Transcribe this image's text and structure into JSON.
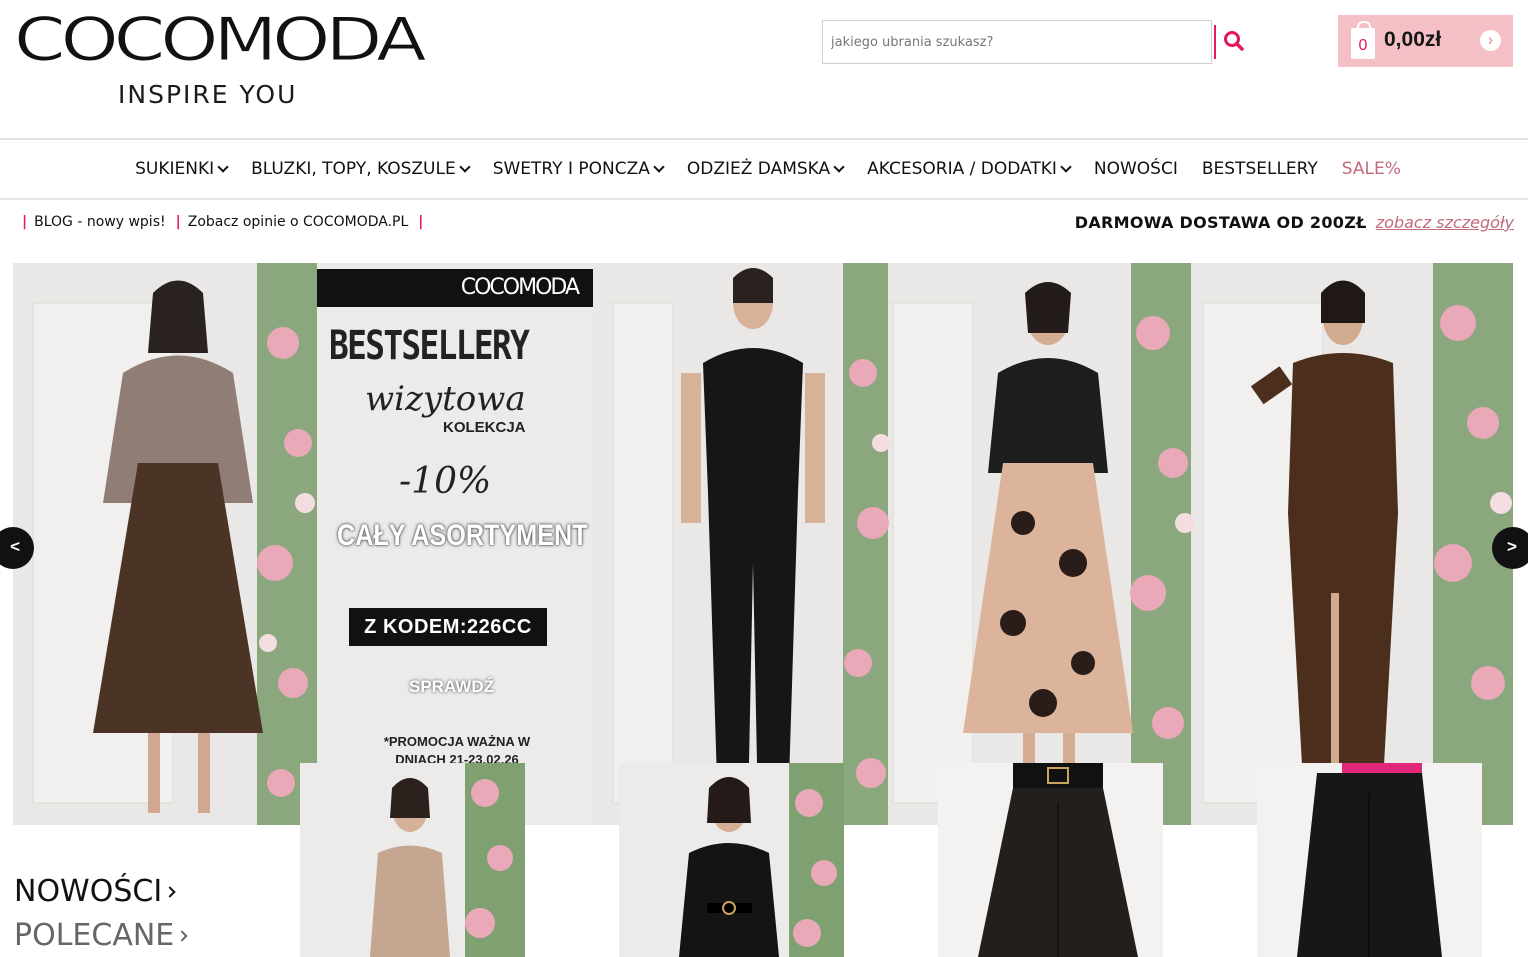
{
  "header": {
    "logo_text": "COCOMODA",
    "logo_tagline": "INSPIRE YOU",
    "search_placeholder": "jakiego ubrania szukasz?",
    "search_icon": "search-icon",
    "cart_count": "0",
    "cart_total": "0,00zł",
    "cart_arrow": "›",
    "accent_color": "#e4185f",
    "cart_bg": "#f4c0c6"
  },
  "nav": {
    "items": [
      {
        "label": "SUKIENKI"
      },
      {
        "label": "BLUZKI, TOPY, KOSZULE"
      },
      {
        "label": "SWETRY I PONCZA"
      },
      {
        "label": "ODZIEŻ DAMSKA"
      },
      {
        "label": "AKCESORIA / DODATKI"
      },
      {
        "label": "NOWOŚCI"
      },
      {
        "label": "BESTSELLERY"
      },
      {
        "label": "SALE%"
      }
    ],
    "sale_color": "#c06a7c"
  },
  "info_bar": {
    "links": [
      "BLOG - nowy wpis!",
      "Zobacz opinie o COCOMODA.PL"
    ],
    "shipping_text": "DARMOWA DOSTAWA OD 200ZŁ",
    "shipping_link": "zobacz szczegóły"
  },
  "banner": {
    "brand": "COCOMODA",
    "headline": "BESTSELLERY",
    "script": "wizytowa",
    "sub": "KOLEKCJA",
    "discount": "-10%",
    "assortment": "CAŁY ASORTYMENT",
    "code": "Z KODEM:226CC",
    "cta": "SPRAWDŹ",
    "note": "*PROMOCJA WAŻNA W DNIACH 21-23.02.26",
    "prev": "<",
    "next": ">"
  },
  "sections": {
    "new": "NOWOŚCI",
    "recommended": "POLECANE"
  },
  "products": [
    {
      "icon": "satin-dress-image"
    },
    {
      "icon": "velvet-dress-image"
    },
    {
      "icon": "wide-trousers-image"
    },
    {
      "icon": "jogger-trousers-image"
    }
  ]
}
